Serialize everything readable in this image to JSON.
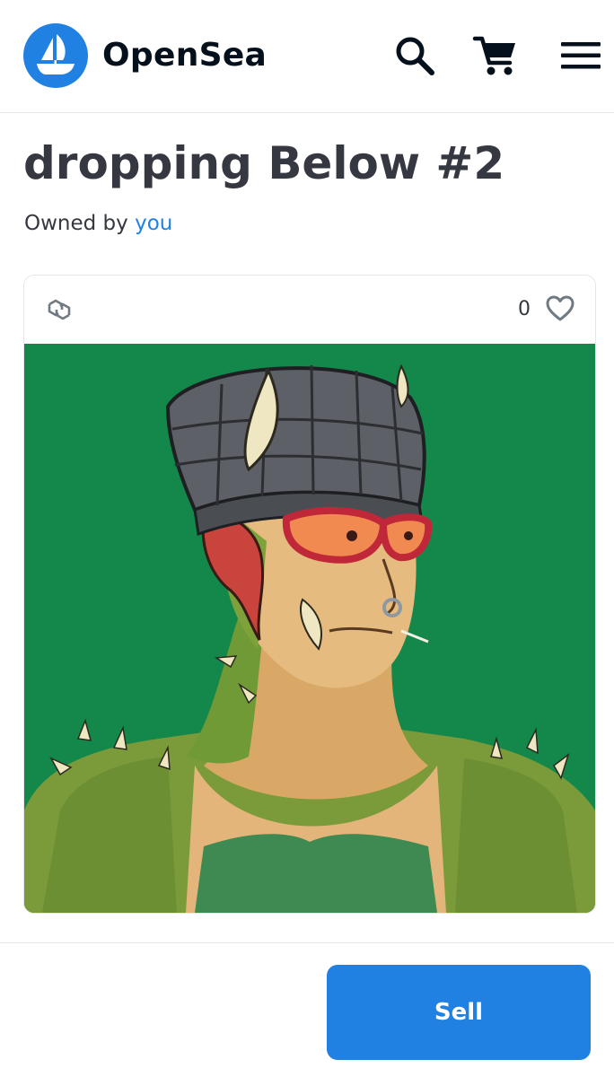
{
  "header": {
    "brand": "OpenSea",
    "icons": [
      "opensea-logo-icon",
      "search-icon",
      "cart-icon",
      "menu-icon"
    ]
  },
  "item": {
    "title": "dropping Below #2",
    "owned_prefix": "Owned by",
    "owner": "you"
  },
  "card": {
    "chain_icon": "polygon-icon",
    "favorites_count": "0",
    "favorite_icon": "heart-icon",
    "artwork_background": "#14874b"
  },
  "footer": {
    "sell_label": "Sell"
  },
  "colors": {
    "accent": "#2081e2",
    "text": "#353840",
    "border": "#e5e8eb"
  }
}
